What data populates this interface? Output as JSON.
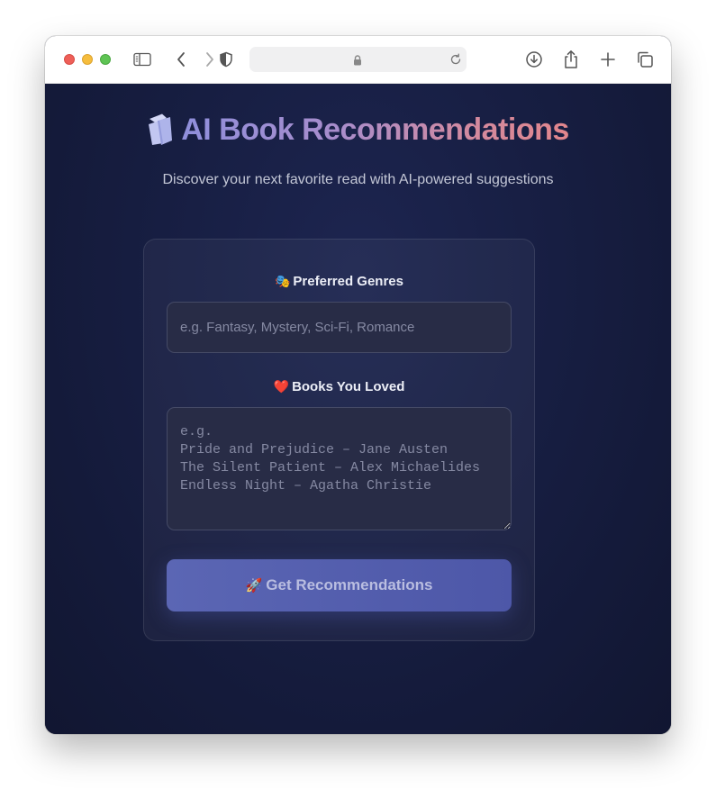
{
  "browser": {
    "address_text": ""
  },
  "hero": {
    "title": "AI Book Recommendations",
    "subtitle": "Discover your next favorite read with AI-powered suggestions"
  },
  "form": {
    "genres": {
      "label_emoji": "🎭",
      "label": "Preferred Genres",
      "value": "",
      "placeholder": "e.g. Fantasy, Mystery, Sci-Fi, Romance"
    },
    "books": {
      "label_emoji": "❤️",
      "label": "Books You Loved",
      "value": "",
      "placeholder": "e.g.\nPride and Prejudice – Jane Austen\nThe Silent Patient – Alex Michaelides\nEndless Night – Agatha Christie"
    },
    "submit": {
      "emoji": "🚀",
      "label": "Get Recommendations"
    }
  },
  "colors": {
    "background": "#141a35",
    "title_gradient_start": "#8f8fdc",
    "title_gradient_end": "#e2868c",
    "button": "#5b66b4"
  },
  "icons": {
    "title_icon": "books-icon"
  }
}
